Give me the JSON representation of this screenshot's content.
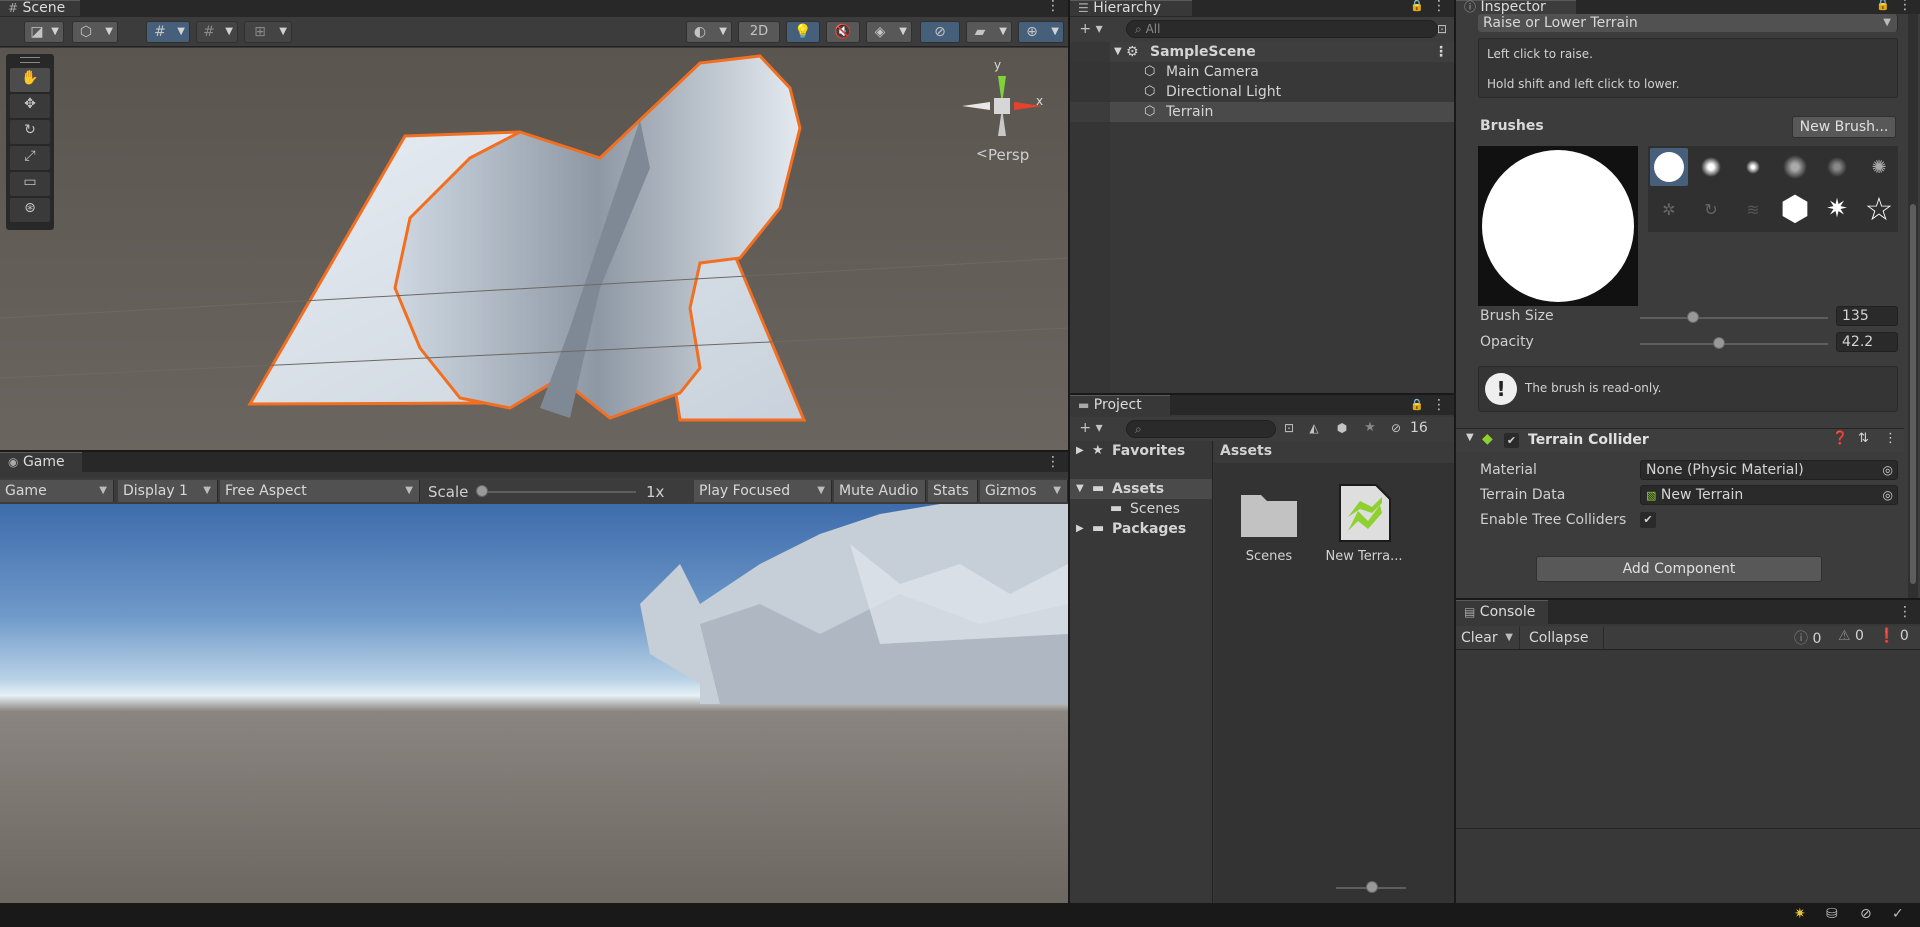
{
  "scene": {
    "tab_label": "Scene",
    "toolbar": {
      "btn_2d": "2D"
    },
    "gizmo": {
      "y_label": "y",
      "x_label": "x",
      "persp_label": "Persp"
    }
  },
  "game": {
    "tab_label": "Game",
    "toolbar": {
      "view": "Game",
      "display": "Display 1",
      "aspect": "Free Aspect",
      "scale_label": "Scale",
      "scale_value": "1x",
      "play_mode": "Play Focused",
      "mute": "Mute Audio",
      "stats": "Stats",
      "gizmos": "Gizmos"
    }
  },
  "hierarchy": {
    "tab_label": "Hierarchy",
    "search_placeholder": "All",
    "scene_name": "SampleScene",
    "items": [
      "Main Camera",
      "Directional Light",
      "Terrain"
    ]
  },
  "project": {
    "tab_label": "Project",
    "hidden_count": "16",
    "tree": {
      "favorites": "Favorites",
      "assets": "Assets",
      "scenes": "Scenes",
      "packages": "Packages"
    },
    "breadcrumb": "Assets",
    "files": [
      {
        "name": "Scenes"
      },
      {
        "name": "New Terra..."
      }
    ]
  },
  "inspector": {
    "tab_label": "Inspector",
    "tool_select": "Raise or Lower Terrain",
    "help_line1": "Left click to raise.",
    "help_line2": "Hold shift and left click to lower.",
    "brushes_label": "Brushes",
    "new_brush_button": "New Brush...",
    "brush_size_label": "Brush Size",
    "brush_size_value": "135",
    "brush_size_fraction": 0.28,
    "opacity_label": "Opacity",
    "opacity_value": "42.2",
    "opacity_fraction": 0.42,
    "readonly_msg": "The brush is read-only.",
    "collider": {
      "title": "Terrain Collider",
      "material_label": "Material",
      "material_value": "None (Physic Material)",
      "terrain_data_label": "Terrain Data",
      "terrain_data_value": "New Terrain",
      "tree_colliders_label": "Enable Tree Colliders"
    },
    "add_component": "Add Component"
  },
  "console": {
    "tab_label": "Console",
    "clear": "Clear",
    "collapse": "Collapse",
    "log_count": "0",
    "warn_count": "0",
    "error_count": "0"
  },
  "colors": {
    "selection_orange": "#f26f21",
    "accent_blue": "#46607c",
    "terrain_green": "#8ed12f"
  }
}
